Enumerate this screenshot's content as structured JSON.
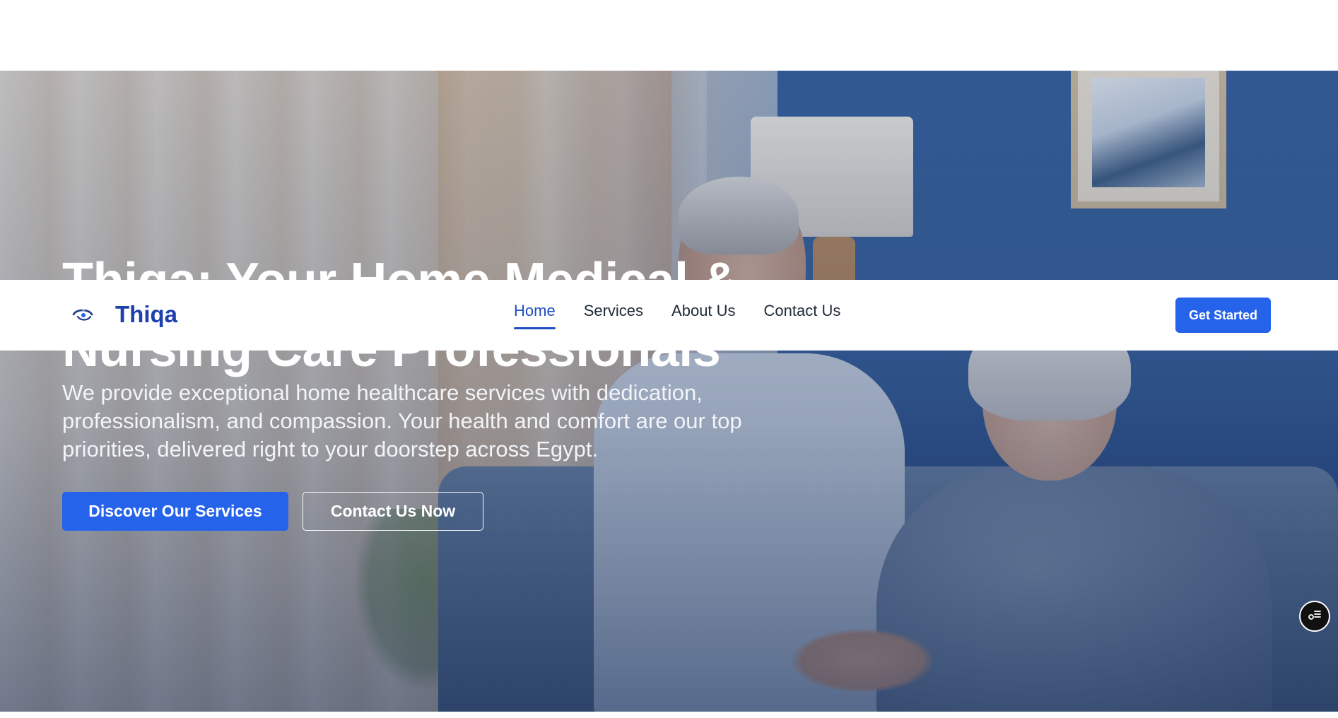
{
  "hero": {
    "title": "Thiqa: Your Home Medical & Nursing Care Professionals",
    "description": "We provide exceptional home healthcare services with dedication, professionalism, and compassion. Your health and comfort are our top priorities, delivered right to your doorstep across Egypt.",
    "primary_button": "Discover Our Services",
    "secondary_button": "Contact Us Now"
  },
  "navbar": {
    "brand": "Thiqa",
    "links": [
      {
        "label": "Home",
        "active": true
      },
      {
        "label": "Services",
        "active": false
      },
      {
        "label": "About Us",
        "active": false
      },
      {
        "label": "Contact Us",
        "active": false
      }
    ],
    "cta": "Get Started"
  },
  "icons": {
    "logo": "thiqa-logo-icon",
    "floating_widget": "accessibility-settings-icon"
  },
  "colors": {
    "accent": "#2563eb",
    "brand": "#1e40af",
    "nav_active": "#1e4fc2"
  }
}
